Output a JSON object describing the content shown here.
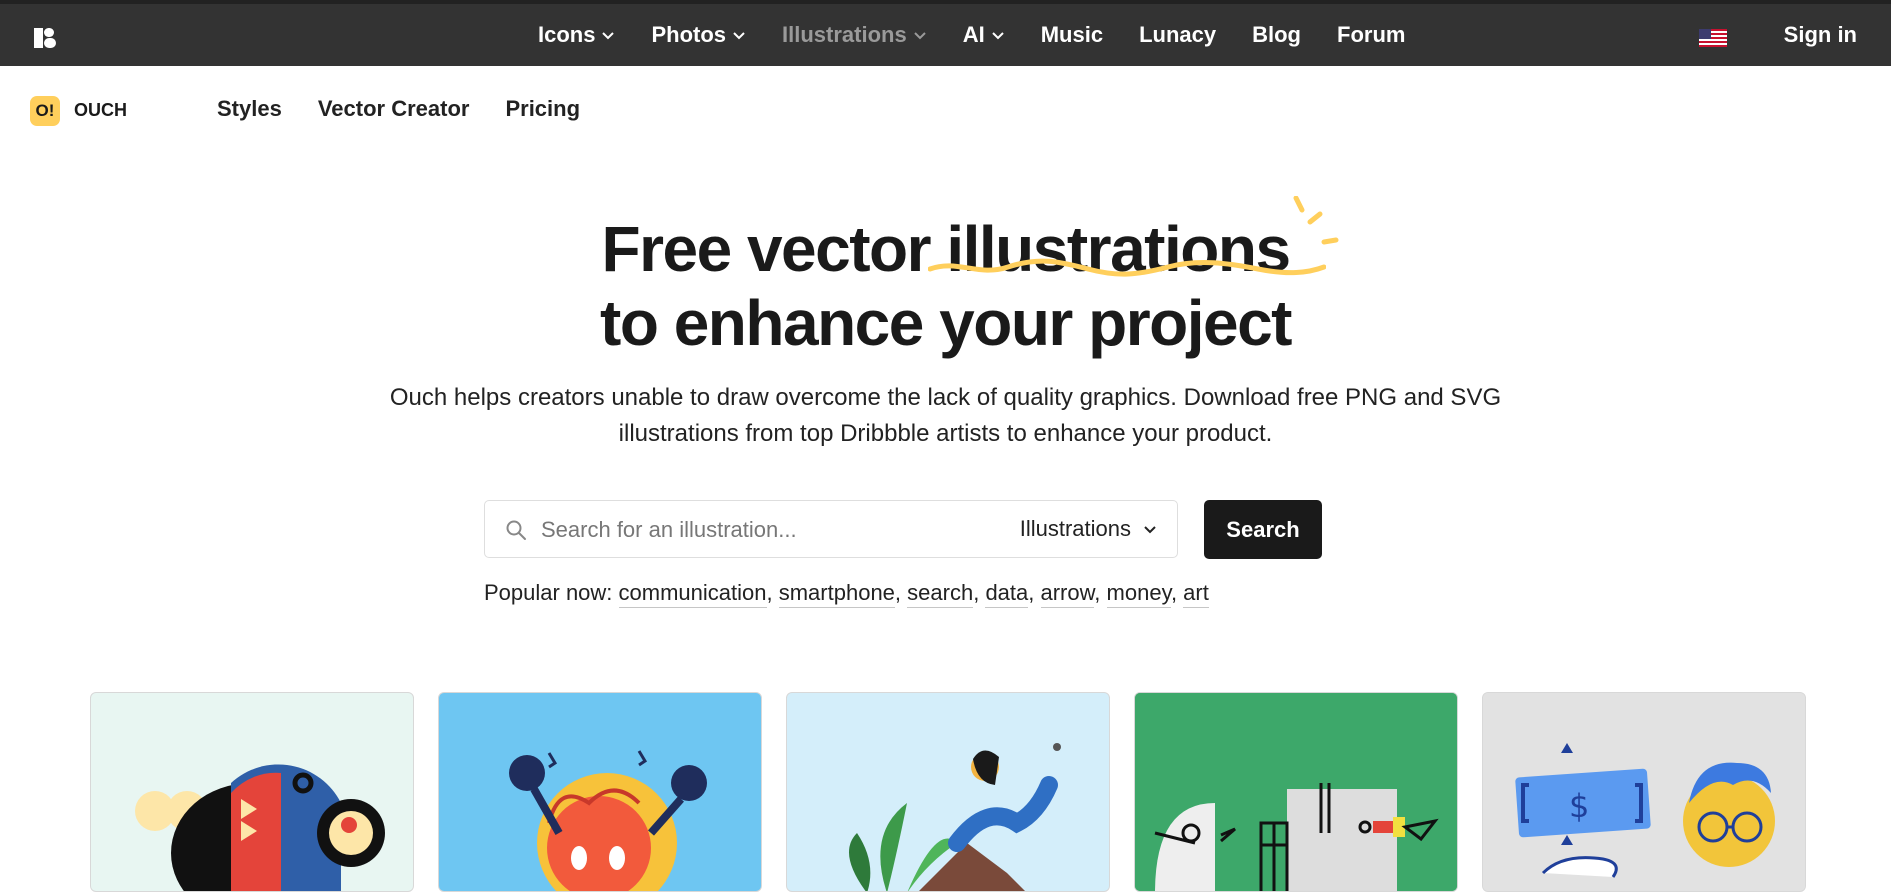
{
  "topnav": {
    "items": [
      {
        "label": "Icons",
        "dropdown": true
      },
      {
        "label": "Photos",
        "dropdown": true
      },
      {
        "label": "Illustrations",
        "dropdown": true,
        "active": true
      },
      {
        "label": "AI",
        "dropdown": true
      },
      {
        "label": "Music"
      },
      {
        "label": "Lunacy"
      },
      {
        "label": "Blog"
      },
      {
        "label": "Forum"
      }
    ],
    "flag_icon": "us-flag-icon",
    "signin_label": "Sign in"
  },
  "subheader": {
    "badge": "O!",
    "brand": "OUCH",
    "items": [
      "Styles",
      "Vector Creator",
      "Pricing"
    ]
  },
  "hero": {
    "title_line1_a": "Free vector ",
    "title_line1_b": "illustrations",
    "title_line2": "to enhance your project",
    "subtitle": "Ouch helps creators unable to draw overcome the lack of quality graphics. Download free PNG and SVG illustrations from top Dribbble artists to enhance your product.",
    "accent_color": "#ffcf5c"
  },
  "search": {
    "placeholder": "Search for an illustration...",
    "type_value": "Illustrations",
    "button_label": "Search"
  },
  "popular": {
    "label": "Popular now:",
    "tags": [
      "communication",
      "smartphone",
      "search",
      "data",
      "arrow",
      "money",
      "art"
    ]
  },
  "cards": [
    {
      "bg": "#e8f6f2"
    },
    {
      "bg": "#6ec6f2"
    },
    {
      "bg": "#d4eefa"
    },
    {
      "bg": "#3da86a"
    },
    {
      "bg": "#e2e2e2"
    }
  ]
}
